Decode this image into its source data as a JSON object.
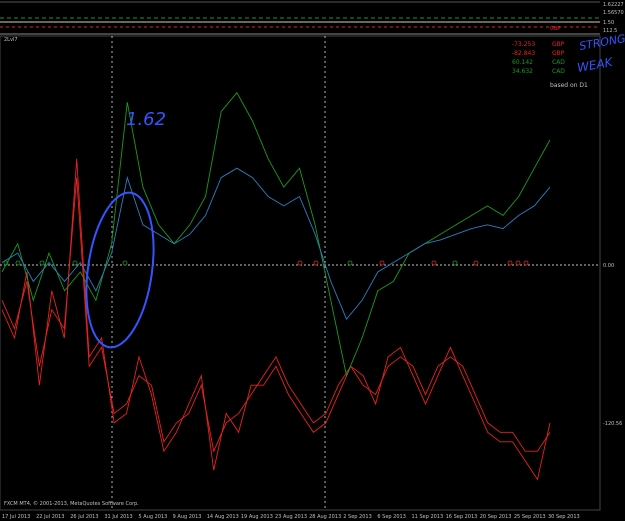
{
  "colors": {
    "background": "#000000",
    "grid": "#ffffff",
    "gbp": "#e8231e",
    "cad": "#1a9c1a",
    "blue": "#2a7fc0",
    "axis_text": "#c0c0c0",
    "annotation": "#3355ff"
  },
  "header": {
    "indicator_label": "2Lvl7",
    "based_on": "based on D1",
    "copyright": "FXCM MT4, © 2001-2013, MetaQuotes Software Corp."
  },
  "legend": [
    {
      "value": "-73.253",
      "name": "GBP",
      "color": "#e8231e"
    },
    {
      "value": "-82.843",
      "name": "GBP",
      "color": "#e8231e"
    },
    {
      "value": "60.142",
      "name": "CAD",
      "color": "#1a9c1a"
    },
    {
      "value": "34.632",
      "name": "CAD",
      "color": "#1a9c1a"
    }
  ],
  "top_panel": {
    "right_labels": [
      "1.62227",
      "1.56570",
      "1.50",
      "112.5"
    ],
    "small_label": "GBP"
  },
  "annotations": {
    "handwritten_1": "1.62",
    "handwritten_2": "STRONG",
    "handwritten_3": "WEAK"
  },
  "chart_data": {
    "type": "line",
    "xlabel": "",
    "ylabel": "",
    "ylim": [
      -120.56,
      0
    ],
    "y_ticks": [
      "0.00",
      "-120.56"
    ],
    "x_tick_labels": [
      "17 Jul 2013",
      "22 Jul 2013",
      "26 Jul 2013",
      "31 Jul 2013",
      "5 Aug 2013",
      "9 Aug 2013",
      "14 Aug 2013",
      "19 Aug 2013",
      "23 Aug 2013",
      "28 Aug 2013",
      "2 Sep 2013",
      "6 Sep 2013",
      "11 Sep 2013",
      "16 Sep 2013",
      "20 Sep 2013",
      "25 Sep 2013",
      "30 Sep 2013"
    ],
    "grid": true,
    "series": [
      {
        "name": "GBP",
        "color": "#e8231e",
        "values": [
          -25,
          -40,
          -5,
          -65,
          -15,
          -40,
          55,
          -50,
          -40,
          -85,
          -80,
          -50,
          -70,
          -100,
          -90,
          -75,
          -60,
          -110,
          -80,
          -90,
          -65,
          -65,
          -55,
          -70,
          -80,
          -90,
          -85,
          -70,
          -55,
          -60,
          -75,
          -50,
          -45,
          -60,
          -75,
          -60,
          -45,
          -60,
          -75,
          -90,
          -95,
          -95,
          -105,
          -115,
          -85
        ]
      },
      {
        "name": "GBP",
        "color": "#e8231e",
        "values": [
          -20,
          -35,
          -10,
          -55,
          -25,
          -35,
          45,
          -55,
          -45,
          -80,
          -75,
          -60,
          -65,
          -95,
          -85,
          -80,
          -65,
          -100,
          -85,
          -80,
          -70,
          -60,
          -50,
          -65,
          -75,
          -85,
          -80,
          -65,
          -55,
          -65,
          -70,
          -55,
          -50,
          -55,
          -70,
          -55,
          -50,
          -55,
          -70,
          -85,
          -90,
          -90,
          -100,
          -100,
          -90
        ]
      },
      {
        "name": "CAD",
        "color": "#1a9c1a",
        "values": [
          -5,
          10,
          -20,
          5,
          -15,
          -5,
          -20,
          10,
          85,
          40,
          20,
          10,
          20,
          35,
          80,
          90,
          75,
          55,
          40,
          50,
          20,
          -20,
          -60,
          -40,
          -15,
          -10,
          5,
          10,
          15,
          20,
          25,
          30,
          25,
          35,
          50,
          65
        ]
      },
      {
        "name": "CAD",
        "color": "#2a7fc0",
        "values": [
          0,
          5,
          -10,
          0,
          -10,
          0,
          -15,
          5,
          45,
          20,
          15,
          10,
          15,
          25,
          45,
          50,
          45,
          35,
          30,
          35,
          15,
          -10,
          -30,
          -20,
          -5,
          0,
          5,
          10,
          12,
          15,
          18,
          20,
          18,
          25,
          30,
          40
        ]
      }
    ]
  }
}
